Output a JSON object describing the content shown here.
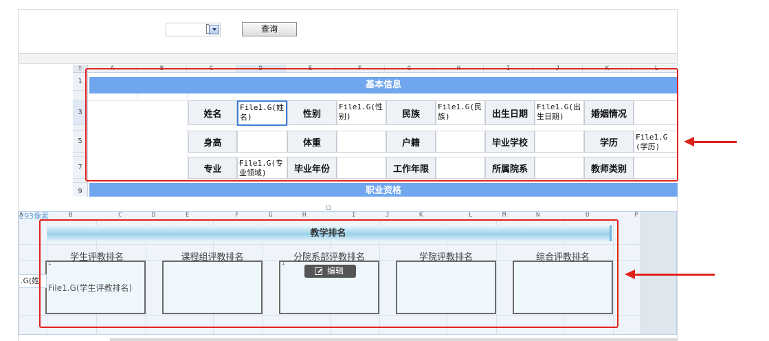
{
  "query_bar": {
    "query_button": "查询"
  },
  "top_sheet": {
    "columns": [
      "A",
      "B",
      "C",
      "D",
      "E",
      "F",
      "G",
      "H",
      "I",
      "J",
      "K",
      "L"
    ],
    "rows": [
      "1",
      "3",
      "5",
      "7",
      "9"
    ],
    "band_basic": "基本信息",
    "band_career": "职业资格",
    "row3": {
      "name_label": "姓名",
      "name_value": "File1.G(姓名)",
      "gender_label": "性别",
      "gender_value": "File1.G(性别)",
      "ethnic_label": "民族",
      "ethnic_value": "File1.G(民族)",
      "birth_label": "出生日期",
      "birth_value": "File1.G(出生日期)",
      "marital_label": "婚姻情况"
    },
    "row5": {
      "height_label": "身高",
      "weight_label": "体重",
      "hukou_label": "户籍",
      "school_label": "毕业学校",
      "edu_label": "学历",
      "edu_value": "File1.G(学历)"
    },
    "row7": {
      "major_label": "专业",
      "major_value": "File1.G(专业领域)",
      "gradyear_label": "毕业年份",
      "workyears_label": "工作年限",
      "dept_label": "所属院系",
      "teacher_type_label": "教师类别"
    }
  },
  "bottom_sheet": {
    "pixel_label": "293像素",
    "columns": [
      "A",
      "B",
      "C",
      "D",
      "E",
      "F",
      "G",
      "H",
      "I",
      "J",
      "K",
      "L",
      "M",
      "N",
      "O",
      "P"
    ],
    "band_title": "教学排名",
    "rank_labels": [
      "学生评教排名",
      "课程组评教排名",
      "分院系部评教排名",
      "学院评教排名",
      "综合评教排名"
    ],
    "first_box_value": "File1.G(学生评教排名)",
    "edit_button": "编辑",
    "left_stub": ".G(姓"
  }
}
